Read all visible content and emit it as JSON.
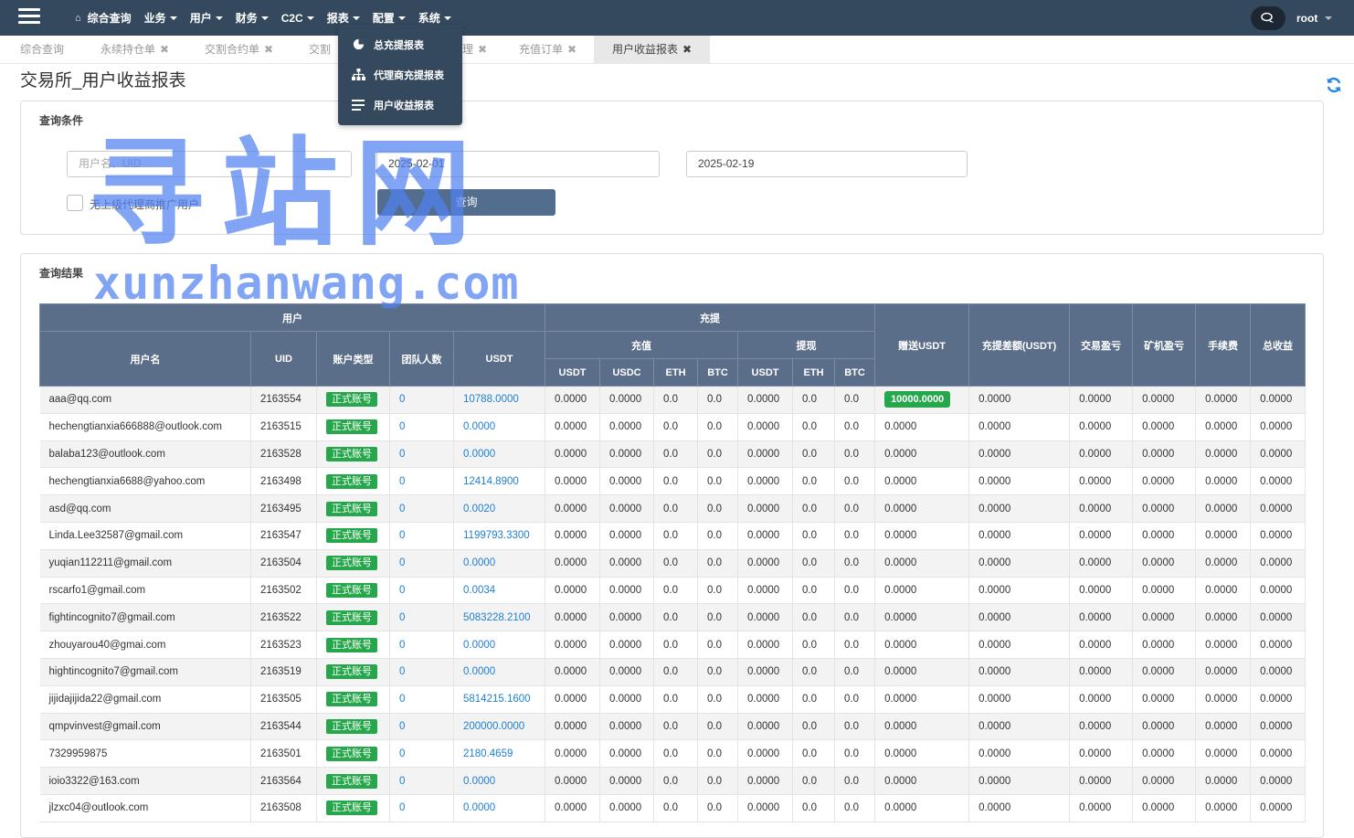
{
  "nav": {
    "menu": [
      "综合查询",
      "业务",
      "用户",
      "财务",
      "C2C",
      "报表",
      "配置",
      "系统"
    ],
    "user": "root"
  },
  "dropdown": [
    "总充提报表",
    "代理商充提报表",
    "用户收益报表"
  ],
  "tabs": [
    {
      "label": "综合查询",
      "closable": false
    },
    {
      "label": "永续持仓单",
      "closable": true
    },
    {
      "label": "交割合约单",
      "closable": true
    },
    {
      "label": "交割",
      "closable": false
    },
    {
      "label": "理",
      "closable": true
    },
    {
      "label": "充值订单",
      "closable": true
    },
    {
      "label": "用户收益报表",
      "closable": true,
      "active": true
    }
  ],
  "page_title": "交易所_用户收益报表",
  "query": {
    "title": "查询条件",
    "user_placeholder": "用户名、UID",
    "date_from": "2025-02-01",
    "date_to": "2025-02-19",
    "checkbox_label": "无上级代理商推广用户",
    "submit_label": "查询"
  },
  "results_title": "查询结果",
  "watermark": {
    "cn": "寻站网",
    "en": "xunzhanwang.com"
  },
  "table": {
    "group_user": "用户",
    "group_charge": "充提",
    "sub_deposit": "充值",
    "sub_withdraw": "提现",
    "col_username": "用户名",
    "col_uid": "UID",
    "col_type": "账户类型",
    "col_team": "团队人数",
    "col_usdt": "USDT",
    "dep_cols": [
      "USDT",
      "USDC",
      "ETH",
      "BTC"
    ],
    "wd_cols": [
      "USDT",
      "ETH",
      "BTC"
    ],
    "col_gift": "赠送USDT",
    "col_diff": "充提差额(USDT)",
    "col_trade": "交易盈亏",
    "col_mining": "矿机盈亏",
    "col_fee": "手续费",
    "col_total": "总收益",
    "rows": [
      {
        "username": "aaa@qq.com",
        "uid": "2163554",
        "type": "正式账号",
        "team": "0",
        "usdt": "10788.0000",
        "dep": [
          "0.0000",
          "0.0000",
          "0.0",
          "0.0"
        ],
        "wd": [
          "0.0000",
          "0.0",
          "0.0"
        ],
        "gift": "10000.0000",
        "diff": "0.0000",
        "trade": "0.0000",
        "mining": "0.0000",
        "fee": "0.0000",
        "total": "0.0000"
      },
      {
        "username": "hechengtianxia666888@outlook.com",
        "uid": "2163515",
        "type": "正式账号",
        "team": "0",
        "usdt": "0.0000",
        "dep": [
          "0.0000",
          "0.0000",
          "0.0",
          "0.0"
        ],
        "wd": [
          "0.0000",
          "0.0",
          "0.0"
        ],
        "gift": "0.0000",
        "diff": "0.0000",
        "trade": "0.0000",
        "mining": "0.0000",
        "fee": "0.0000",
        "total": "0.0000"
      },
      {
        "username": "balaba123@outlook.com",
        "uid": "2163528",
        "type": "正式账号",
        "team": "0",
        "usdt": "0.0000",
        "dep": [
          "0.0000",
          "0.0000",
          "0.0",
          "0.0"
        ],
        "wd": [
          "0.0000",
          "0.0",
          "0.0"
        ],
        "gift": "0.0000",
        "diff": "0.0000",
        "trade": "0.0000",
        "mining": "0.0000",
        "fee": "0.0000",
        "total": "0.0000"
      },
      {
        "username": "hechengtianxia6688@yahoo.com",
        "uid": "2163498",
        "type": "正式账号",
        "team": "0",
        "usdt": "12414.8900",
        "dep": [
          "0.0000",
          "0.0000",
          "0.0",
          "0.0"
        ],
        "wd": [
          "0.0000",
          "0.0",
          "0.0"
        ],
        "gift": "0.0000",
        "diff": "0.0000",
        "trade": "0.0000",
        "mining": "0.0000",
        "fee": "0.0000",
        "total": "0.0000"
      },
      {
        "username": "asd@qq.com",
        "uid": "2163495",
        "type": "正式账号",
        "team": "0",
        "usdt": "0.0020",
        "dep": [
          "0.0000",
          "0.0000",
          "0.0",
          "0.0"
        ],
        "wd": [
          "0.0000",
          "0.0",
          "0.0"
        ],
        "gift": "0.0000",
        "diff": "0.0000",
        "trade": "0.0000",
        "mining": "0.0000",
        "fee": "0.0000",
        "total": "0.0000"
      },
      {
        "username": "Linda.Lee32587@gmail.com",
        "uid": "2163547",
        "type": "正式账号",
        "team": "0",
        "usdt": "1199793.3300",
        "dep": [
          "0.0000",
          "0.0000",
          "0.0",
          "0.0"
        ],
        "wd": [
          "0.0000",
          "0.0",
          "0.0"
        ],
        "gift": "0.0000",
        "diff": "0.0000",
        "trade": "0.0000",
        "mining": "0.0000",
        "fee": "0.0000",
        "total": "0.0000"
      },
      {
        "username": "yuqian112211@gmail.com",
        "uid": "2163504",
        "type": "正式账号",
        "team": "0",
        "usdt": "0.0000",
        "dep": [
          "0.0000",
          "0.0000",
          "0.0",
          "0.0"
        ],
        "wd": [
          "0.0000",
          "0.0",
          "0.0"
        ],
        "gift": "0.0000",
        "diff": "0.0000",
        "trade": "0.0000",
        "mining": "0.0000",
        "fee": "0.0000",
        "total": "0.0000"
      },
      {
        "username": "rscarfo1@gmail.com",
        "uid": "2163502",
        "type": "正式账号",
        "team": "0",
        "usdt": "0.0034",
        "dep": [
          "0.0000",
          "0.0000",
          "0.0",
          "0.0"
        ],
        "wd": [
          "0.0000",
          "0.0",
          "0.0"
        ],
        "gift": "0.0000",
        "diff": "0.0000",
        "trade": "0.0000",
        "mining": "0.0000",
        "fee": "0.0000",
        "total": "0.0000"
      },
      {
        "username": "fightincognito7@gmail.com",
        "uid": "2163522",
        "type": "正式账号",
        "team": "0",
        "usdt": "5083228.2100",
        "dep": [
          "0.0000",
          "0.0000",
          "0.0",
          "0.0"
        ],
        "wd": [
          "0.0000",
          "0.0",
          "0.0"
        ],
        "gift": "0.0000",
        "diff": "0.0000",
        "trade": "0.0000",
        "mining": "0.0000",
        "fee": "0.0000",
        "total": "0.0000"
      },
      {
        "username": "zhouyarou40@gmai.com",
        "uid": "2163523",
        "type": "正式账号",
        "team": "0",
        "usdt": "0.0000",
        "dep": [
          "0.0000",
          "0.0000",
          "0.0",
          "0.0"
        ],
        "wd": [
          "0.0000",
          "0.0",
          "0.0"
        ],
        "gift": "0.0000",
        "diff": "0.0000",
        "trade": "0.0000",
        "mining": "0.0000",
        "fee": "0.0000",
        "total": "0.0000"
      },
      {
        "username": "hightincognito7@gmail.com",
        "uid": "2163519",
        "type": "正式账号",
        "team": "0",
        "usdt": "0.0000",
        "dep": [
          "0.0000",
          "0.0000",
          "0.0",
          "0.0"
        ],
        "wd": [
          "0.0000",
          "0.0",
          "0.0"
        ],
        "gift": "0.0000",
        "diff": "0.0000",
        "trade": "0.0000",
        "mining": "0.0000",
        "fee": "0.0000",
        "total": "0.0000"
      },
      {
        "username": "jijidajijida22@gmail.com",
        "uid": "2163505",
        "type": "正式账号",
        "team": "0",
        "usdt": "5814215.1600",
        "dep": [
          "0.0000",
          "0.0000",
          "0.0",
          "0.0"
        ],
        "wd": [
          "0.0000",
          "0.0",
          "0.0"
        ],
        "gift": "0.0000",
        "diff": "0.0000",
        "trade": "0.0000",
        "mining": "0.0000",
        "fee": "0.0000",
        "total": "0.0000"
      },
      {
        "username": "qmpvinvest@gmail.com",
        "uid": "2163544",
        "type": "正式账号",
        "team": "0",
        "usdt": "200000.0000",
        "dep": [
          "0.0000",
          "0.0000",
          "0.0",
          "0.0"
        ],
        "wd": [
          "0.0000",
          "0.0",
          "0.0"
        ],
        "gift": "0.0000",
        "diff": "0.0000",
        "trade": "0.0000",
        "mining": "0.0000",
        "fee": "0.0000",
        "total": "0.0000"
      },
      {
        "username": "7329959875",
        "uid": "2163501",
        "type": "正式账号",
        "team": "0",
        "usdt": "2180.4659",
        "dep": [
          "0.0000",
          "0.0000",
          "0.0",
          "0.0"
        ],
        "wd": [
          "0.0000",
          "0.0",
          "0.0"
        ],
        "gift": "0.0000",
        "diff": "0.0000",
        "trade": "0.0000",
        "mining": "0.0000",
        "fee": "0.0000",
        "total": "0.0000"
      },
      {
        "username": "ioio3322@163.com",
        "uid": "2163564",
        "type": "正式账号",
        "team": "0",
        "usdt": "0.0000",
        "dep": [
          "0.0000",
          "0.0000",
          "0.0",
          "0.0"
        ],
        "wd": [
          "0.0000",
          "0.0",
          "0.0"
        ],
        "gift": "0.0000",
        "diff": "0.0000",
        "trade": "0.0000",
        "mining": "0.0000",
        "fee": "0.0000",
        "total": "0.0000"
      },
      {
        "username": "jlzxc04@outlook.com",
        "uid": "2163508",
        "type": "正式账号",
        "team": "0",
        "usdt": "0.0000",
        "dep": [
          "0.0000",
          "0.0000",
          "0.0",
          "0.0"
        ],
        "wd": [
          "0.0000",
          "0.0",
          "0.0"
        ],
        "gift": "0.0000",
        "diff": "0.0000",
        "trade": "0.0000",
        "mining": "0.0000",
        "fee": "0.0000",
        "total": "0.0000"
      }
    ]
  }
}
